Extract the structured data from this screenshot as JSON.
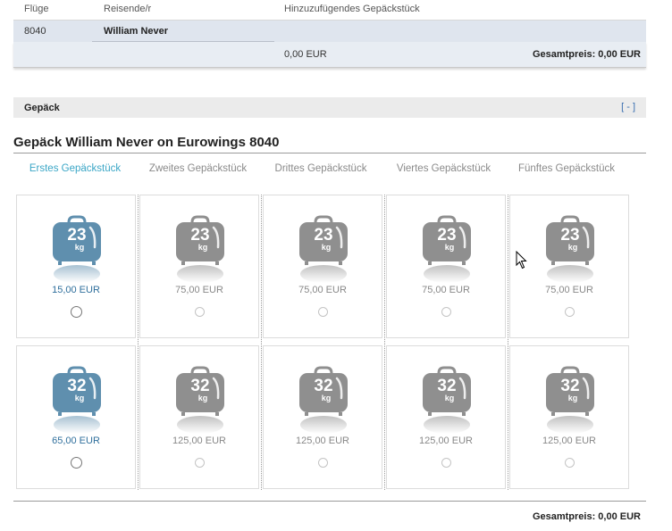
{
  "summary": {
    "headers": {
      "flights": "Flüge",
      "traveller": "Reisende/r",
      "baggage": "Hinzuzufügendes Gepäckstück"
    },
    "row": {
      "flight": "8040",
      "traveller": "William Never"
    },
    "footer": {
      "amount": "0,00 EUR",
      "total": "Gesamtpreis: 0,00 EUR"
    }
  },
  "baggage_bar": {
    "label": "Gepäck",
    "toggle": "[ - ]"
  },
  "section_title": "Gepäck William Never on Eurowings 8040",
  "tabs": [
    {
      "label": "Erstes Gepäckstück",
      "active": true
    },
    {
      "label": "Zweites Gepäckstück",
      "active": false
    },
    {
      "label": "Drittes Gepäckstück",
      "active": false
    },
    {
      "label": "Viertes Gepäckstück",
      "active": false
    },
    {
      "label": "Fünftes Gepäckstück",
      "active": false
    }
  ],
  "options": [
    {
      "weight": "23",
      "unit": "kg",
      "prices": [
        "15,00 EUR",
        "75,00 EUR",
        "75,00 EUR",
        "75,00 EUR",
        "75,00 EUR"
      ]
    },
    {
      "weight": "32",
      "unit": "kg",
      "prices": [
        "65,00 EUR",
        "125,00 EUR",
        "125,00 EUR",
        "125,00 EUR",
        "125,00 EUR"
      ]
    }
  ],
  "colors": {
    "active_bag": "#5f8fae",
    "inactive_bag": "#8f8f8f",
    "active_tab": "#3aa6c6",
    "active_price": "#2f6f9c"
  },
  "footer_total": "Gesamtpreis: 0,00 EUR"
}
